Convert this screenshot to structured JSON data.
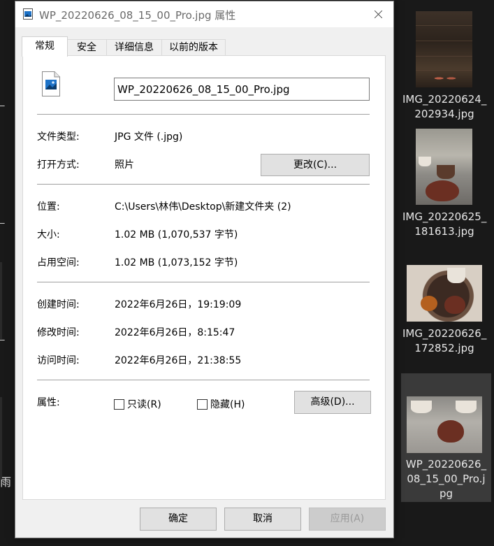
{
  "dialog": {
    "title": "WP_20220626_08_15_00_Pro.jpg 属性",
    "tabs": [
      {
        "label": "常规",
        "active": true
      },
      {
        "label": "安全",
        "active": false
      },
      {
        "label": "详细信息",
        "active": false
      },
      {
        "label": "以前的版本",
        "active": false
      }
    ],
    "file_name": "WP_20220626_08_15_00_Pro.jpg",
    "file_type": {
      "label": "文件类型:",
      "value": "JPG 文件 (.jpg)"
    },
    "open_with": {
      "label": "打开方式:",
      "value": "照片",
      "change_button": "更改(C)..."
    },
    "location": {
      "label": "位置:",
      "value": "C:\\Users\\林伟\\Desktop\\新建文件夹 (2)"
    },
    "size": {
      "label": "大小:",
      "value": "1.02 MB (1,070,537 字节)"
    },
    "size_on_disk": {
      "label": "占用空间:",
      "value": "1.02 MB (1,073,152 字节)"
    },
    "created": {
      "label": "创建时间:",
      "value": "2022年6月26日，19:19:09"
    },
    "modified": {
      "label": "修改时间:",
      "value": "2022年6月26日，8:15:47"
    },
    "accessed": {
      "label": "访问时间:",
      "value": "2022年6月26日，21:38:55"
    },
    "attributes": {
      "label": "属性:",
      "readonly": {
        "label": "只读(R)",
        "checked": false
      },
      "hidden": {
        "label": "隐藏(H)",
        "checked": false
      },
      "advanced_button": "高级(D)..."
    },
    "buttons": {
      "ok": "确定",
      "cancel": "取消",
      "apply": "应用(A)"
    },
    "colors": {
      "accent_icon": "#1e73c8",
      "dialog_bg": "#f0f0f0",
      "explorer_bg": "#191919"
    }
  },
  "explorer": {
    "edge_fragment": "雨",
    "files": [
      {
        "line1": "IMG_20220624_",
        "line2": "202934.jpg",
        "selected": false
      },
      {
        "line1": "IMG_20220625_",
        "line2": "181613.jpg",
        "selected": false
      },
      {
        "line1": "IMG_20220626_",
        "line2": "172852.jpg",
        "selected": false
      },
      {
        "line1": "WP_20220626_",
        "line2": "08_15_00_Pro.j",
        "line3": "pg",
        "selected": true
      }
    ]
  }
}
